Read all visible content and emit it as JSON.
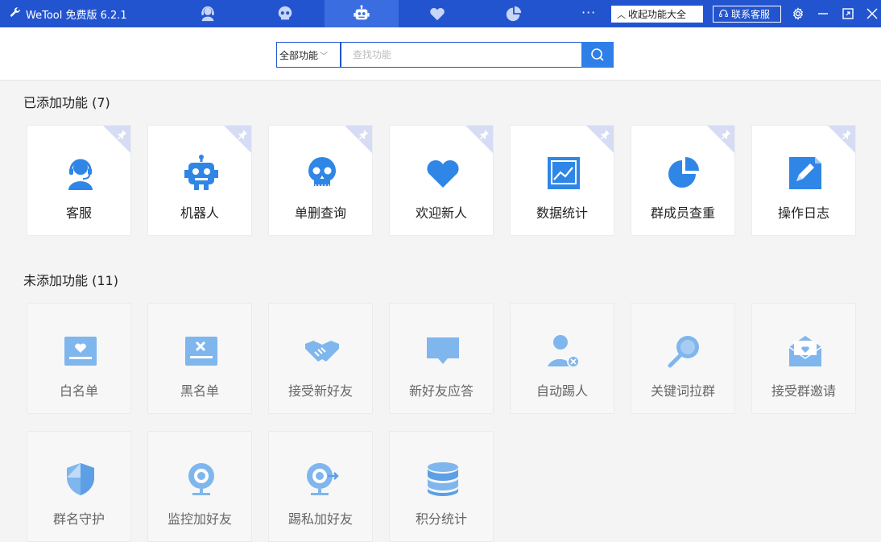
{
  "app": {
    "title": "WeTool 免费版 6.2.1"
  },
  "titlebar": {
    "more": "···",
    "collapse_label": "收起功能大全",
    "contact_label": "联系客服"
  },
  "search": {
    "scope": "全部功能",
    "placeholder": "查找功能",
    "value": ""
  },
  "added": {
    "title": "已添加功能 (7)",
    "items": [
      {
        "label": "客服",
        "icon": "headset-icon"
      },
      {
        "label": "机器人",
        "icon": "robot-icon"
      },
      {
        "label": "单删查询",
        "icon": "skull-icon"
      },
      {
        "label": "欢迎新人",
        "icon": "heart-icon"
      },
      {
        "label": "数据统计",
        "icon": "chart-icon"
      },
      {
        "label": "群成员查重",
        "icon": "pie-icon"
      },
      {
        "label": "操作日志",
        "icon": "edit-icon"
      }
    ]
  },
  "not_added": {
    "title": "未添加功能 (11)",
    "items": [
      {
        "label": "白名单",
        "icon": "whitelist-icon"
      },
      {
        "label": "黑名单",
        "icon": "blacklist-icon"
      },
      {
        "label": "接受新好友",
        "icon": "handshake-icon"
      },
      {
        "label": "新好友应答",
        "icon": "message-icon"
      },
      {
        "label": "自动踢人",
        "icon": "kick-user-icon"
      },
      {
        "label": "关键词拉群",
        "icon": "search-key-icon"
      },
      {
        "label": "接受群邀请",
        "icon": "mail-icon"
      },
      {
        "label": "群名守护",
        "icon": "shield-icon"
      },
      {
        "label": "监控加好友",
        "icon": "webcam-icon"
      },
      {
        "label": "踢私加好友",
        "icon": "kick-cam-icon"
      },
      {
        "label": "积分统计",
        "icon": "database-icon"
      }
    ]
  },
  "colors": {
    "titlebar": "#2354cf",
    "accent": "#2f7fe8",
    "icon_blue": "#2f86e6",
    "icon_light": "#7fb6ee"
  }
}
